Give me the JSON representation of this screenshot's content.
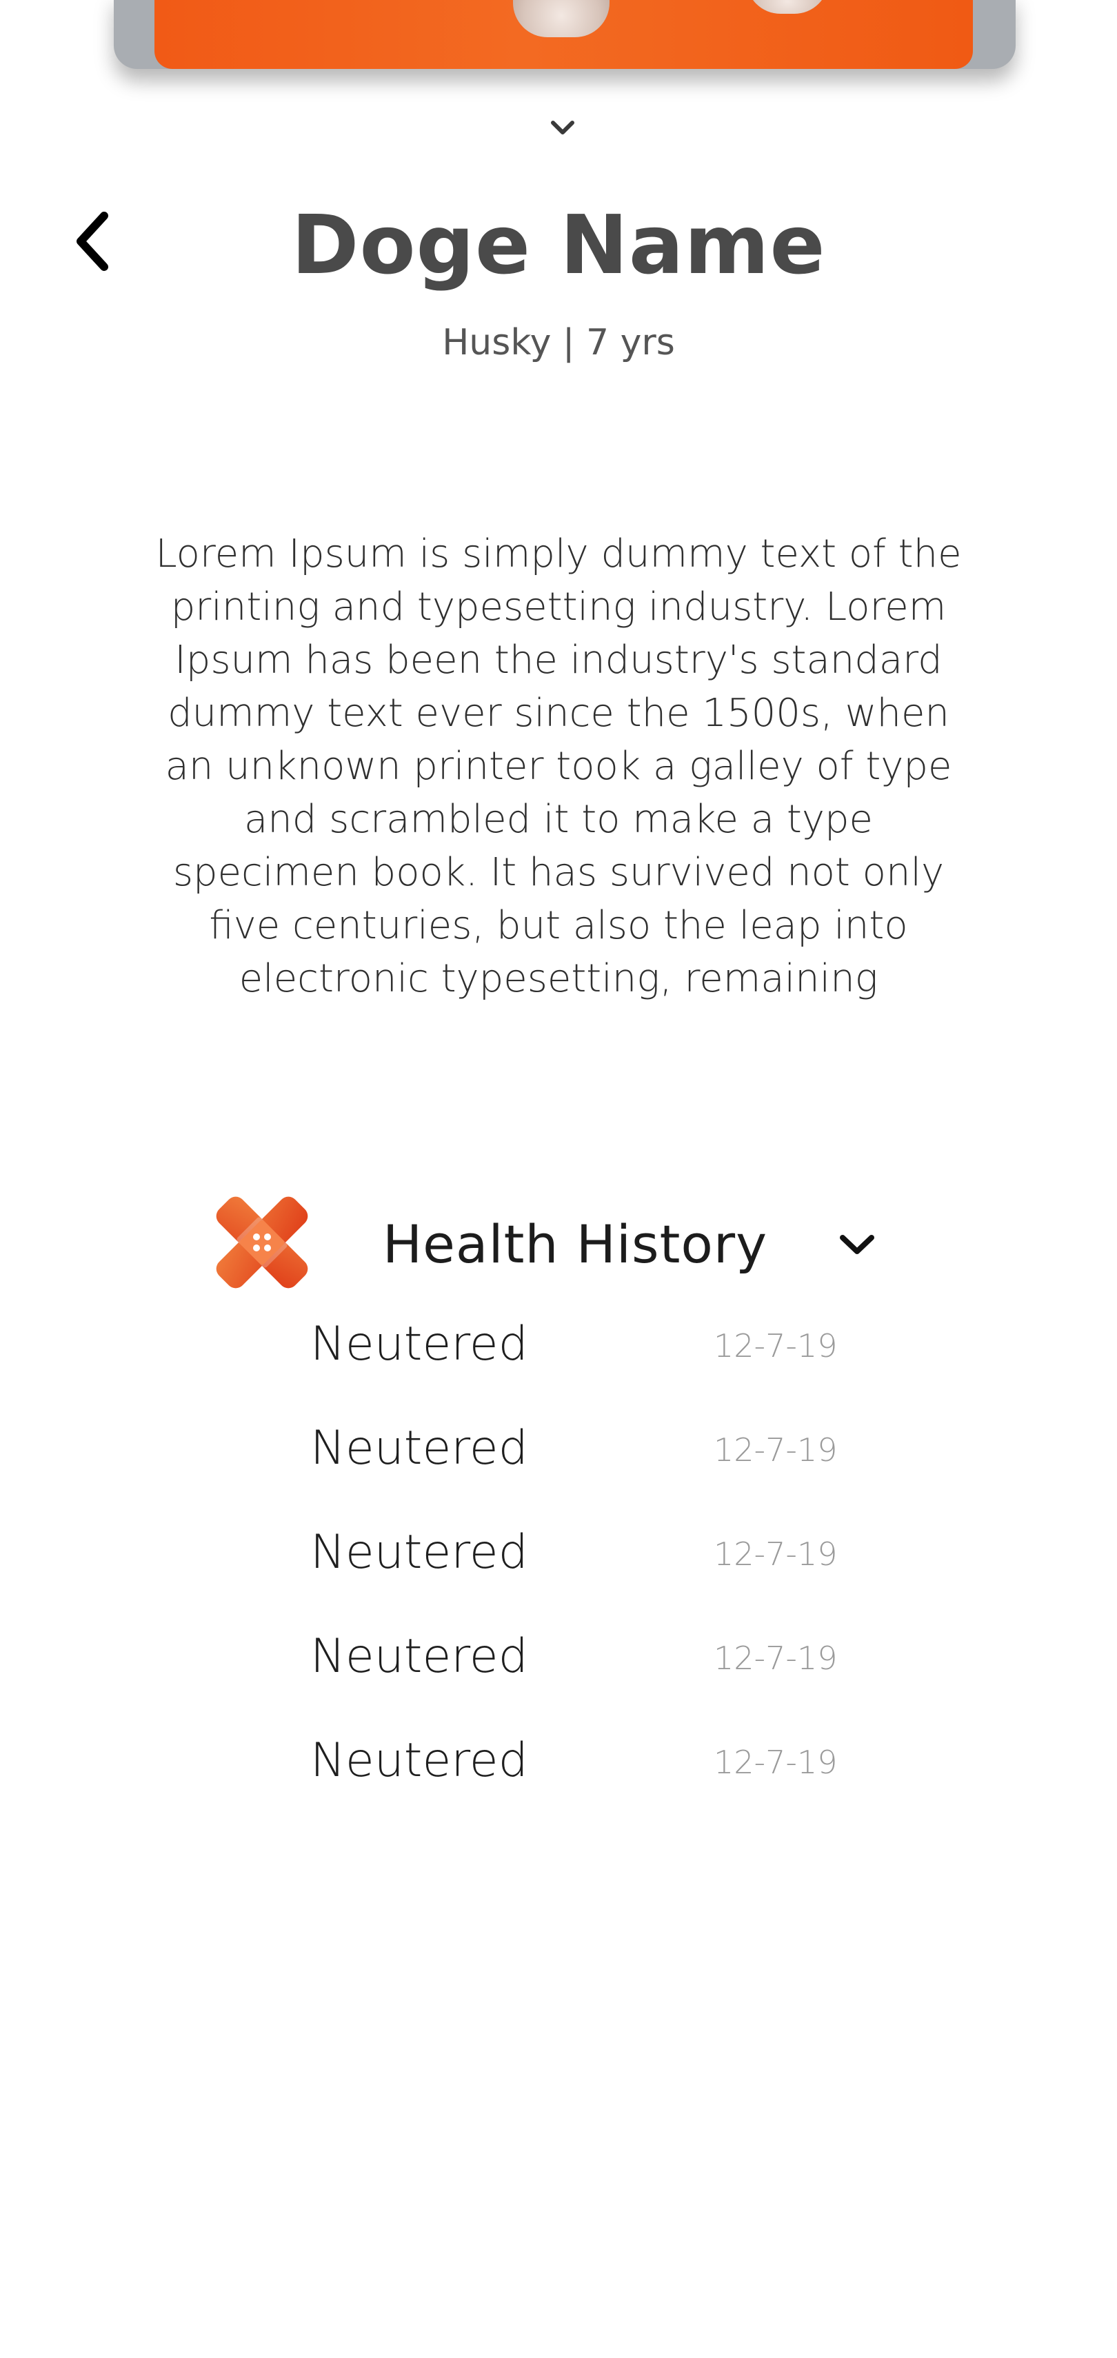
{
  "header": {
    "title": "Doge Name",
    "subtitle": "Husky | 7 yrs"
  },
  "description": "Lorem Ipsum is simply dummy text of the printing and typesetting industry. Lorem Ipsum has been the industry's standard dummy text ever since the 1500s, when an unknown printer took a galley of type and scrambled it to make a type specimen book. It has survived not only five centuries, but also the leap into electronic typesetting, remaining",
  "health": {
    "title": "Health History",
    "icon": "bandage-icon",
    "accent_color": "#ef5a24",
    "items": [
      {
        "label": "Neutered",
        "date": "12-7-19"
      },
      {
        "label": "Neutered",
        "date": "12-7-19"
      },
      {
        "label": "Neutered",
        "date": "12-7-19"
      },
      {
        "label": "Neutered",
        "date": "12-7-19"
      },
      {
        "label": "Neutered",
        "date": "12-7-19"
      }
    ]
  },
  "colors": {
    "photo_background": "#f15a16",
    "title_text": "#4a4a4a"
  }
}
